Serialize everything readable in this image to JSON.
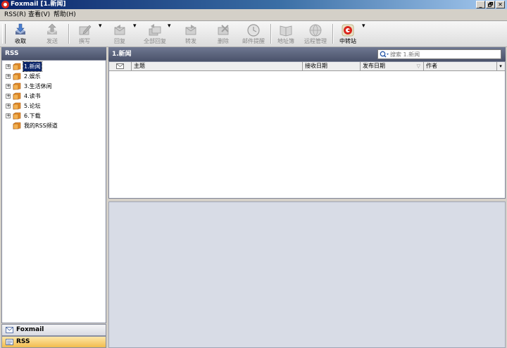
{
  "window": {
    "title": "Foxmail [1.新闻]",
    "controls": [
      "_",
      "🗗",
      "✕"
    ]
  },
  "menubar": {
    "items": [
      "RSS(R)",
      "查看(V)",
      "帮助(H)"
    ]
  },
  "toolbar": {
    "buttons": [
      {
        "label": "收取",
        "icon": "receive-icon",
        "enabled": true
      },
      {
        "label": "发送",
        "icon": "send-icon",
        "enabled": false
      },
      {
        "label": "撰写",
        "icon": "compose-icon",
        "enabled": false
      },
      {
        "label": "回复",
        "icon": "reply-icon",
        "enabled": false
      },
      {
        "label": "全部回复",
        "icon": "reply-all-icon",
        "enabled": false
      },
      {
        "label": "转发",
        "icon": "forward-icon",
        "enabled": false
      },
      {
        "label": "删除",
        "icon": "delete-icon",
        "enabled": false
      },
      {
        "label": "邮件提醒",
        "icon": "clock-icon",
        "enabled": false
      },
      {
        "label": "地址簿",
        "icon": "address-book-icon",
        "enabled": false
      },
      {
        "label": "远程管理",
        "icon": "remote-icon",
        "enabled": false
      },
      {
        "label": "中转站",
        "icon": "transfer-station-icon",
        "enabled": true
      }
    ],
    "dropdown_glyph": "▾"
  },
  "left_pane": {
    "header": "RSS",
    "tree": [
      {
        "label": "1.新闻",
        "selected": true,
        "expandable": true
      },
      {
        "label": "2.娱乐",
        "selected": false,
        "expandable": true
      },
      {
        "label": "3.生活休闲",
        "selected": false,
        "expandable": true
      },
      {
        "label": "4.读书",
        "selected": false,
        "expandable": true
      },
      {
        "label": "5.论坛",
        "selected": false,
        "expandable": true
      },
      {
        "label": "6.下载",
        "selected": false,
        "expandable": true
      },
      {
        "label": "我的RSS频道",
        "selected": false,
        "expandable": false
      }
    ],
    "expand_glyph": "+",
    "nav_buttons": [
      {
        "label": "Foxmail",
        "icon": "mail-envelope-icon",
        "active": false
      },
      {
        "label": "RSS",
        "icon": "rss-list-icon",
        "active": true
      }
    ]
  },
  "main": {
    "title": "1.新闻",
    "search": {
      "placeholder": "搜索 1.新闻",
      "value": ""
    },
    "columns": [
      "",
      "主题",
      "接收日期",
      "发布日期",
      "作者"
    ],
    "sort_glyph": "▽",
    "column_menu_glyph": "▾",
    "rows": []
  },
  "colors": {
    "title_gradient_start": "#0a246a",
    "pane_header": "#5a6279",
    "rss_active_tab": "#f7c75a",
    "selection": "#0a246a",
    "preview_bg": "#d8dce6"
  }
}
